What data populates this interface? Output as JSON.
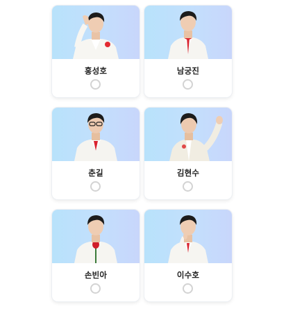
{
  "candidates": [
    {
      "name": "홍성호",
      "selected": false,
      "pose": "hand-to-head",
      "accent": "#e32a32"
    },
    {
      "name": "남궁진",
      "selected": false,
      "pose": "tie",
      "accent": "#d9232f"
    },
    {
      "name": "춘길",
      "selected": false,
      "pose": "glasses",
      "accent": "#d9232f"
    },
    {
      "name": "김현수",
      "selected": false,
      "pose": "wave",
      "accent": "#e04a4a"
    },
    {
      "name": "손빈아",
      "selected": false,
      "pose": "rose",
      "accent": "#d01e2a"
    },
    {
      "name": "이수호",
      "selected": false,
      "pose": "finger-chin",
      "accent": "#d9232f"
    }
  ],
  "colors": {
    "photo_bg": "#c3dffd",
    "radio_border": "#d3d3d3",
    "name_text": "#222222"
  }
}
